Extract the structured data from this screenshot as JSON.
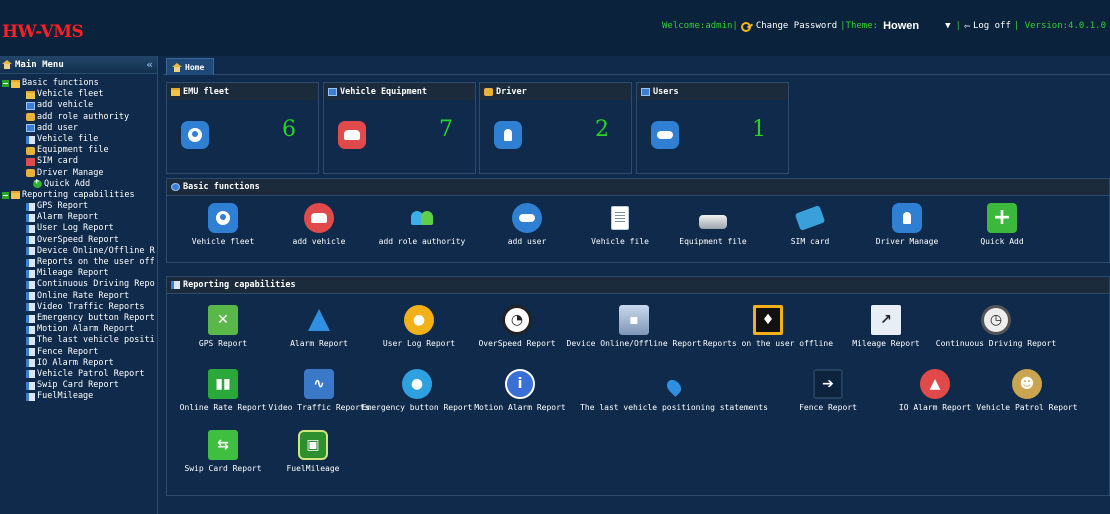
{
  "app": {
    "logo": "HW-VMS",
    "welcome": "Welcome:admin|",
    "change_password": "Change Password",
    "theme_label": "|Theme:",
    "theme_value": "Howen",
    "sep": "|",
    "logoff": "Log off",
    "version": "| Version:4.0.1.0"
  },
  "sidebar": {
    "title": "Main Menu",
    "collapse_glyph": "«",
    "tree": [
      {
        "label": "Basic functions",
        "level": 0,
        "icon": "folder-icon"
      },
      {
        "label": "Vehicle fleet",
        "level": 1,
        "icon": "folder-icon"
      },
      {
        "label": "add vehicle",
        "level": 1,
        "icon": "car-icon"
      },
      {
        "label": "add role authority",
        "level": 1,
        "icon": "role-icon"
      },
      {
        "label": "add user",
        "level": 1,
        "icon": "user-icon"
      },
      {
        "label": "Vehicle file",
        "level": 1,
        "icon": "file-icon"
      },
      {
        "label": "Equipment file",
        "level": 1,
        "icon": "equipment-icon"
      },
      {
        "label": "SIM card",
        "level": 1,
        "icon": "sim-icon"
      },
      {
        "label": "Driver Manage",
        "level": 1,
        "icon": "driver-icon"
      },
      {
        "label": "Quick Add",
        "level": 2,
        "icon": "plus-icon"
      },
      {
        "label": "Reporting capabilities",
        "level": 0,
        "icon": "folder-icon"
      },
      {
        "label": "GPS Report",
        "level": 1,
        "icon": "report-icon"
      },
      {
        "label": "Alarm Report",
        "level": 1,
        "icon": "report-icon"
      },
      {
        "label": "User Log Report",
        "level": 1,
        "icon": "report-icon"
      },
      {
        "label": "OverSpeed Report",
        "level": 1,
        "icon": "report-icon"
      },
      {
        "label": "Device Online/Offline R",
        "level": 1,
        "icon": "report-icon"
      },
      {
        "label": "Reports on the user off",
        "level": 1,
        "icon": "report-icon"
      },
      {
        "label": "Mileage Report",
        "level": 1,
        "icon": "report-icon"
      },
      {
        "label": "Continuous Driving Repo",
        "level": 1,
        "icon": "report-icon"
      },
      {
        "label": "Online Rate Report",
        "level": 1,
        "icon": "report-icon"
      },
      {
        "label": "Video Traffic Reports",
        "level": 1,
        "icon": "report-icon"
      },
      {
        "label": "Emergency button Report",
        "level": 1,
        "icon": "report-icon"
      },
      {
        "label": "Motion Alarm Report",
        "level": 1,
        "icon": "report-icon"
      },
      {
        "label": "The last vehicle positi",
        "level": 1,
        "icon": "report-icon"
      },
      {
        "label": "Fence Report",
        "level": 1,
        "icon": "report-icon"
      },
      {
        "label": "IO Alarm Report",
        "level": 1,
        "icon": "report-icon"
      },
      {
        "label": "Vehicle Patrol Report",
        "level": 1,
        "icon": "report-icon"
      },
      {
        "label": "Swip Card Report",
        "level": 1,
        "icon": "report-icon"
      },
      {
        "label": "FuelMileage",
        "level": 1,
        "icon": "report-icon"
      }
    ]
  },
  "main": {
    "home_tab": "Home",
    "stats": [
      {
        "title": "EMU fleet",
        "value": "6",
        "icon": "globe-icon"
      },
      {
        "title": "Vehicle Equipment",
        "value": "7",
        "icon": "car-icon"
      },
      {
        "title": "Driver",
        "value": "2",
        "icon": "driver-icon"
      },
      {
        "title": "Users",
        "value": "1",
        "icon": "users-icon"
      }
    ],
    "basic_panel_title": "Basic functions",
    "basic_items": [
      {
        "label": "Vehicle fleet",
        "icon": "globe-icon"
      },
      {
        "label": "add vehicle",
        "icon": "car-icon"
      },
      {
        "label": "add role authority",
        "icon": "role-icon"
      },
      {
        "label": "add user",
        "icon": "users-icon"
      },
      {
        "label": "Vehicle file",
        "icon": "file-icon"
      },
      {
        "label": "Equipment file",
        "icon": "drive-icon"
      },
      {
        "label": "SIM card",
        "icon": "sim-icon"
      },
      {
        "label": "Driver Manage",
        "icon": "driver-icon"
      },
      {
        "label": "Quick Add",
        "icon": "plus-icon"
      }
    ],
    "report_panel_title": "Reporting capabilities",
    "report_items": [
      {
        "label": "GPS Report",
        "icon": "satellite-icon"
      },
      {
        "label": "Alarm Report",
        "icon": "alarm-icon"
      },
      {
        "label": "User Log Report",
        "icon": "fire-icon"
      },
      {
        "label": "OverSpeed Report",
        "icon": "gauge-icon"
      },
      {
        "label": "Device Online/Offline Report",
        "icon": "monitor-icon"
      },
      {
        "label": "Reports on the user offline",
        "icon": "lock-icon"
      },
      {
        "label": "Mileage Report",
        "icon": "chart-icon"
      },
      {
        "label": "Continuous Driving Report",
        "icon": "clock-icon"
      },
      {
        "label": "Online Rate Report",
        "icon": "bars-icon"
      },
      {
        "label": "Video Traffic Reports",
        "icon": "traffic-icon"
      },
      {
        "label": "Emergency button Report",
        "icon": "disc-icon"
      },
      {
        "label": "Motion Alarm Report",
        "icon": "info-icon"
      },
      {
        "label": "The last vehicle positioning statements",
        "icon": "pin-icon"
      },
      {
        "label": "Fence Report",
        "icon": "fence-icon"
      },
      {
        "label": "IO Alarm Report",
        "icon": "io-icon"
      },
      {
        "label": "Vehicle Patrol Report",
        "icon": "patrol-icon"
      },
      {
        "label": "Swip Card Report",
        "icon": "swap-icon"
      },
      {
        "label": "FuelMileage",
        "icon": "fuel-icon"
      }
    ]
  }
}
